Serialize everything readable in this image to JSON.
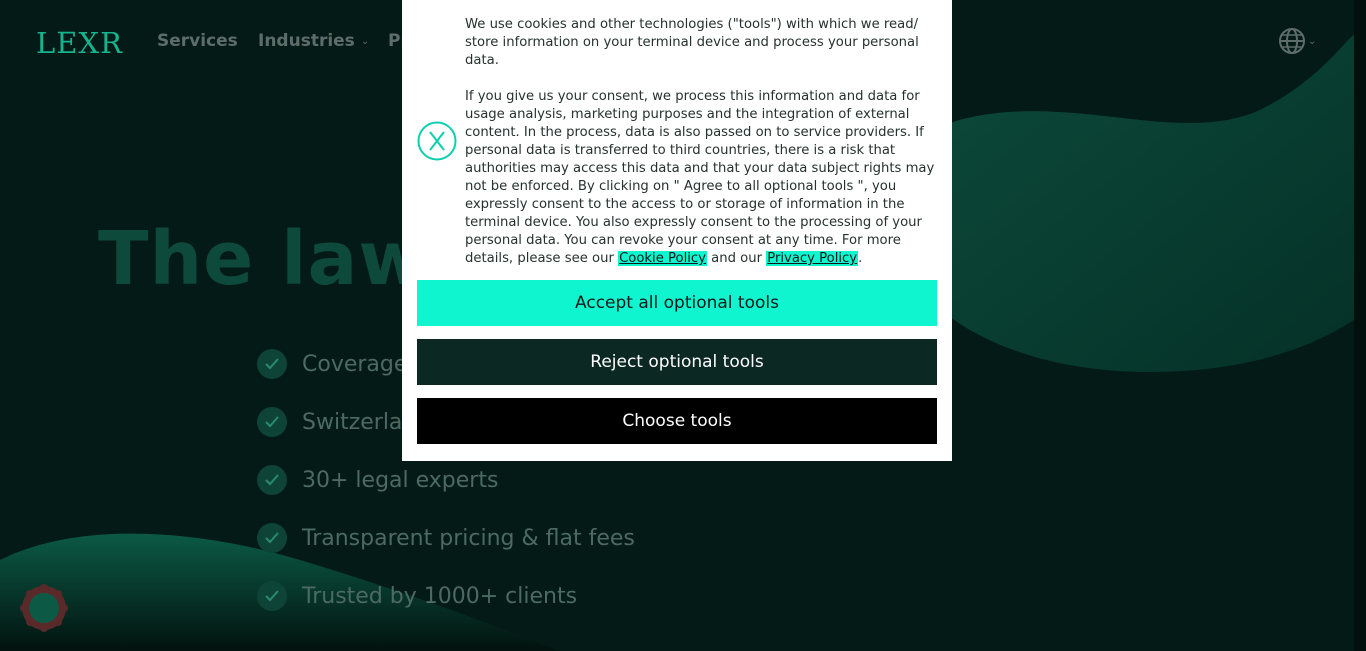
{
  "colors": {
    "brand_green": "#16b48e",
    "accent_mint": "#0ef5cf",
    "background_dark": "#031a16",
    "reject_button": "#0b2823",
    "choose_button": "#000000"
  },
  "nav": {
    "logo": "LEXR",
    "items": [
      {
        "label": "Services"
      },
      {
        "label": "Industries",
        "icon": "chevron-down-icon"
      },
      {
        "label": "Pr"
      }
    ],
    "language_icon": "globe-icon"
  },
  "hero": {
    "title": "The law f                                      mpanies",
    "features": [
      {
        "text": "Coverage"
      },
      {
        "text": "Switzerla"
      },
      {
        "text": "30+ legal experts"
      },
      {
        "text": "Transparent pricing & flat fees"
      },
      {
        "text": "Trusted by 1000+ clients"
      }
    ]
  },
  "consent": {
    "paragraph1": "We use cookies and other technologies (\"tools\") with which we read/ store information on your terminal device and process your personal data.",
    "paragraph2_text": "If you give us your consent, we process this information and data for usage analysis, marketing purposes and the integration of external content. In the process, data is also passed on to service providers. If personal data is transferred to third countries, there is a risk that authorities may access this data and that your data subject rights may not be enforced. By clicking on \" Agree to all optional tools \", you expressly consent to the access to or storage of information in the terminal device. You also expressly consent to the processing of your personal data. You can revoke your consent at any time. For more details, please see our",
    "cookie_policy_link": "Cookie Policy",
    "and_our": "and our",
    "privacy_policy_link": "Privacy Policy",
    "period": ".",
    "accept_label": "Accept all optional tools",
    "reject_label": "Reject optional tools",
    "choose_label": "Choose tools"
  }
}
